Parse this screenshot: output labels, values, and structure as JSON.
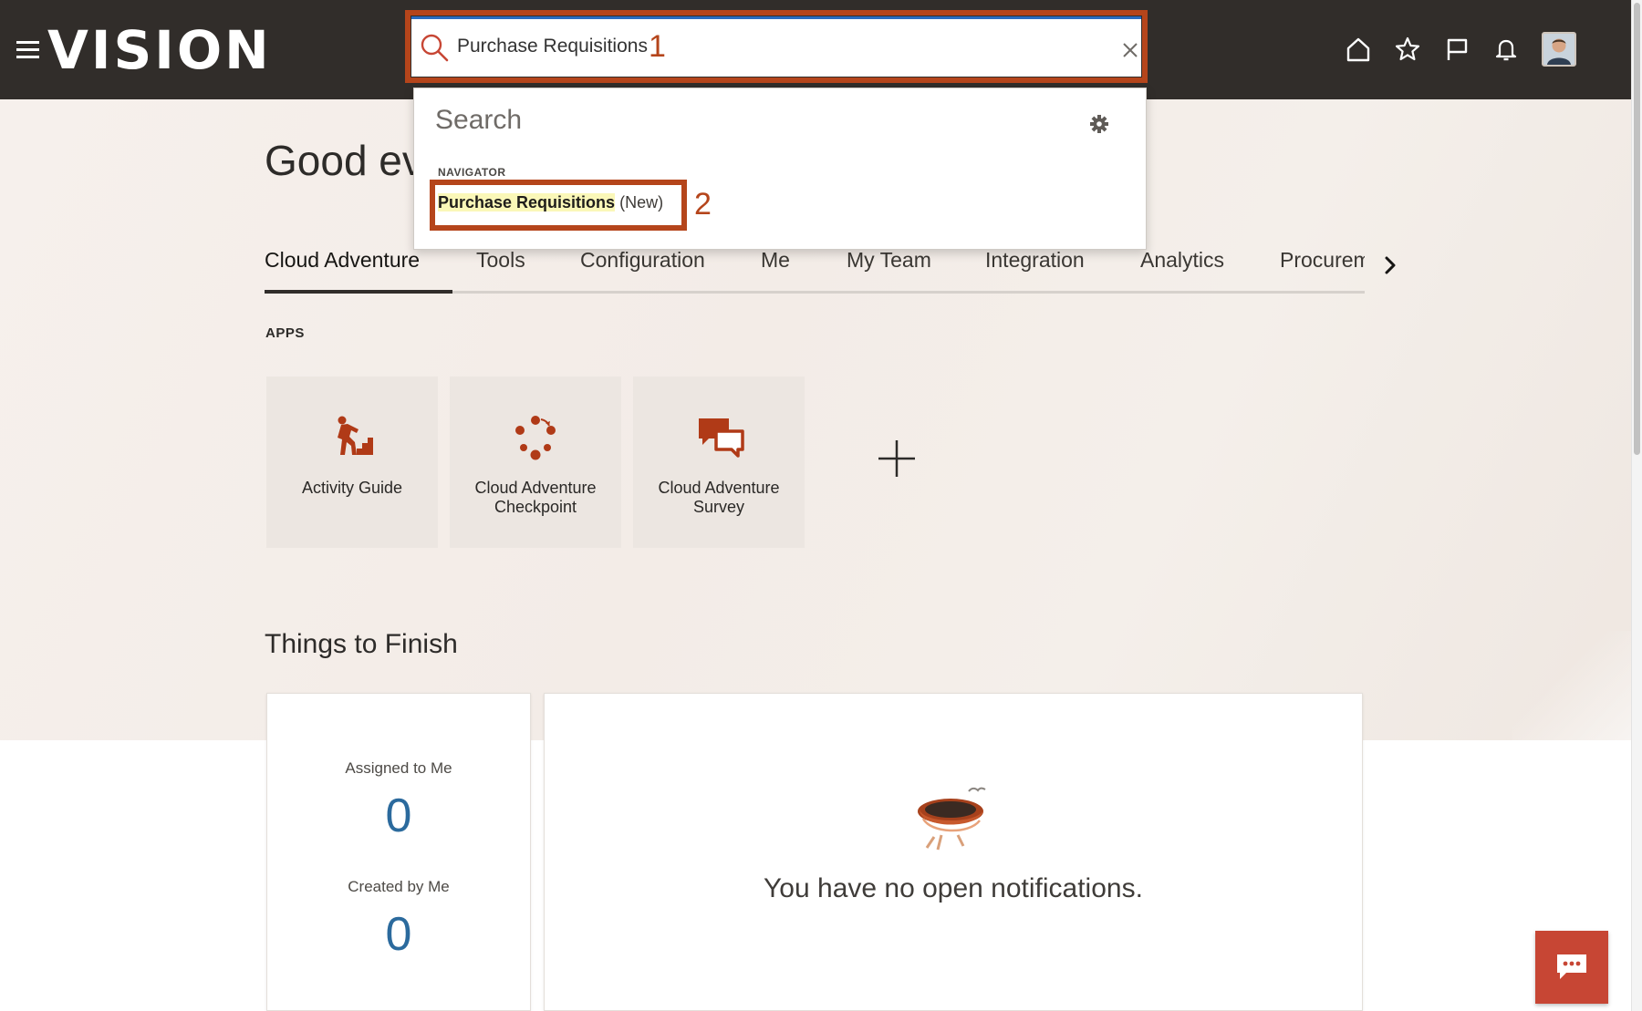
{
  "header": {
    "brand": "VISION",
    "icons": [
      "home-icon",
      "star-icon",
      "flag-icon",
      "bell-icon"
    ]
  },
  "search": {
    "value": "Purchase Requisitions",
    "dropdown": {
      "title": "Search",
      "section": "NAVIGATOR",
      "result": {
        "match": "Purchase Requisitions",
        "suffix": "(New)"
      }
    }
  },
  "callouts": [
    "1",
    "2"
  ],
  "main": {
    "greeting": "Good eve",
    "tabs": [
      "Cloud Adventure",
      "Tools",
      "Configuration",
      "Me",
      "My Team",
      "Integration",
      "Analytics",
      "Procurem"
    ],
    "apps_label": "APPS",
    "apps": [
      {
        "label": "Activity Guide",
        "icon": "activity-guide-icon"
      },
      {
        "label": "Cloud Adventure Checkpoint",
        "icon": "checkpoint-icon"
      },
      {
        "label": "Cloud Adventure Survey",
        "icon": "survey-icon"
      }
    ],
    "things_title": "Things to Finish",
    "assigned_label": "Assigned to Me",
    "assigned_count": "0",
    "created_label": "Created by Me",
    "created_count": "0",
    "empty_message": "You have no open notifications."
  },
  "colors": {
    "header_bg": "#312d2a",
    "annotation": "#b5451b",
    "app_icon": "#b03a17",
    "count": "#2b6a9d",
    "chat_button": "#c74634"
  }
}
